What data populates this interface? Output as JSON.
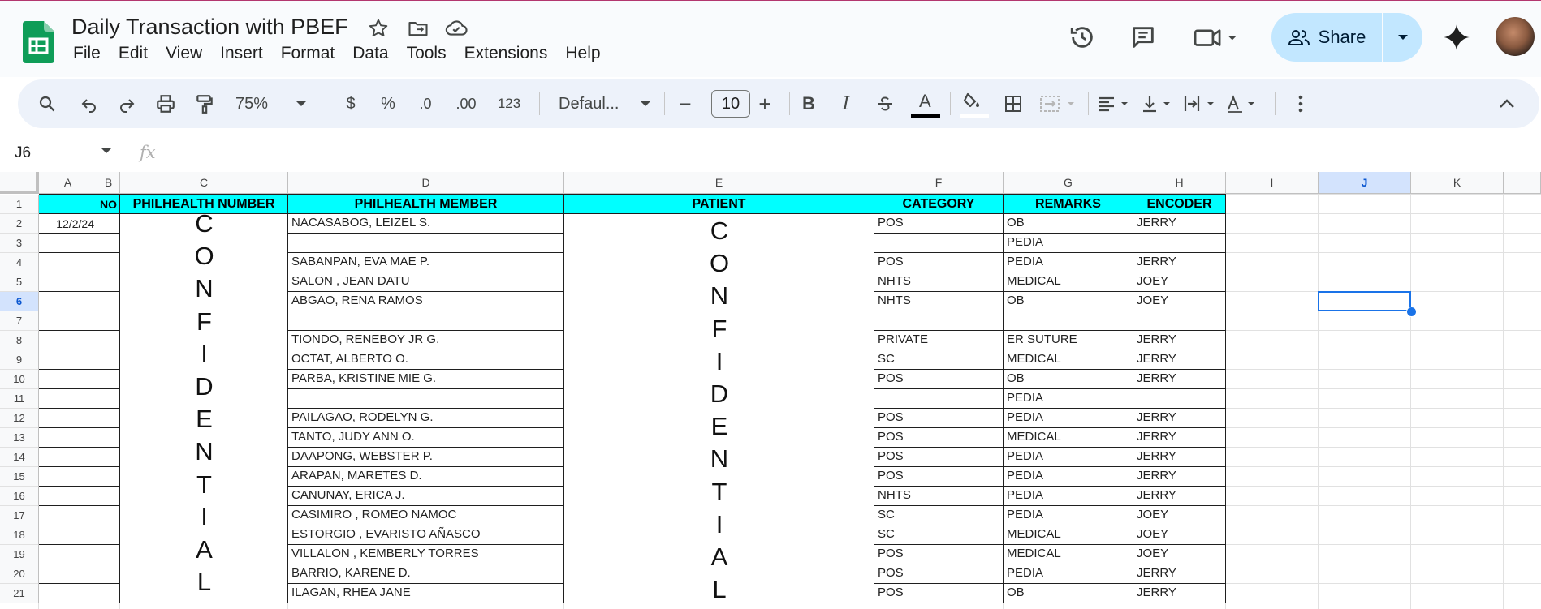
{
  "app": {
    "title": "Daily Transaction with PBEF",
    "menu": [
      "File",
      "Edit",
      "View",
      "Insert",
      "Format",
      "Data",
      "Tools",
      "Extensions",
      "Help"
    ],
    "share_label": "Share"
  },
  "toolbar": {
    "zoom": "75%",
    "currency": "$",
    "percent": "%",
    "dec_decrease": ".0",
    "dec_increase": ".00",
    "num_format": "123",
    "font": "Defaul...",
    "font_size": "10",
    "minus": "−",
    "plus": "+",
    "bold": "B",
    "italic": "I",
    "text_color": "A"
  },
  "formula_bar": {
    "cell_ref": "J6",
    "fx": "fx",
    "value": ""
  },
  "sheet": {
    "columns": [
      "A",
      "B",
      "C",
      "D",
      "E",
      "F",
      "G",
      "H",
      "I",
      "J",
      "K"
    ],
    "selected_column": "J",
    "selected_row": "6",
    "rows": [
      "1",
      "2",
      "3",
      "4",
      "5",
      "6",
      "7",
      "8",
      "9",
      "10",
      "11",
      "12",
      "13",
      "14",
      "15",
      "16",
      "17",
      "18",
      "19",
      "20",
      "21"
    ],
    "headers": {
      "no": "NO",
      "philhealth_number": "PHILHEALTH NUMBER",
      "philhealth_member": "PHILHEALTH MEMBER",
      "patient": "PATIENT",
      "category": "CATEGORY",
      "remarks": "REMARKS",
      "encoder": "ENCODER"
    },
    "date_a2": "12/2/24",
    "confidential_c": [
      "C",
      "O",
      "N",
      "F",
      "I",
      "D",
      "E",
      "N",
      "T",
      "I",
      "A",
      "L"
    ],
    "confidential_e": [
      "C",
      "O",
      "N",
      "F",
      "I",
      "D",
      "E",
      "N",
      "T",
      "I",
      "A",
      "L"
    ],
    "data_rows": [
      {
        "member": "NACASABOG, LEIZEL S.",
        "category": "POS",
        "remarks": "OB",
        "encoder": "JERRY"
      },
      {
        "member": "",
        "category": "",
        "remarks": "PEDIA",
        "encoder": ""
      },
      {
        "member": "SABANPAN, EVA MAE P.",
        "category": "POS",
        "remarks": "PEDIA",
        "encoder": "JERRY"
      },
      {
        "member": "SALON , JEAN DATU",
        "category": "NHTS",
        "remarks": "MEDICAL",
        "encoder": "JOEY"
      },
      {
        "member": "ABGAO, RENA RAMOS",
        "category": "NHTS",
        "remarks": "OB",
        "encoder": "JOEY"
      },
      {
        "member": "",
        "category": "",
        "remarks": "",
        "encoder": ""
      },
      {
        "member": "TIONDO, RENEBOY JR G.",
        "category": "PRIVATE",
        "remarks": "ER SUTURE",
        "encoder": "JERRY"
      },
      {
        "member": "OCTAT, ALBERTO O.",
        "category": "SC",
        "remarks": "MEDICAL",
        "encoder": "JERRY"
      },
      {
        "member": "PARBA, KRISTINE MIE G.",
        "category": "POS",
        "remarks": "OB",
        "encoder": "JERRY"
      },
      {
        "member": "",
        "category": "",
        "remarks": "PEDIA",
        "encoder": ""
      },
      {
        "member": "PAILAGAO, RODELYN G.",
        "category": "POS",
        "remarks": "PEDIA",
        "encoder": "JERRY"
      },
      {
        "member": "TANTO, JUDY ANN O.",
        "category": "POS",
        "remarks": "MEDICAL",
        "encoder": "JERRY"
      },
      {
        "member": "DAAPONG, WEBSTER P.",
        "category": "POS",
        "remarks": "PEDIA",
        "encoder": "JERRY"
      },
      {
        "member": "ARAPAN, MARETES D.",
        "category": "POS",
        "remarks": "PEDIA",
        "encoder": "JERRY"
      },
      {
        "member": "CANUNAY, ERICA J.",
        "category": "NHTS",
        "remarks": "PEDIA",
        "encoder": "JERRY"
      },
      {
        "member": "CASIMIRO , ROMEO NAMOC",
        "category": "SC",
        "remarks": "PEDIA",
        "encoder": "JOEY"
      },
      {
        "member": "ESTORGIO , EVARISTO AÑASCO",
        "category": "SC",
        "remarks": "MEDICAL",
        "encoder": "JOEY"
      },
      {
        "member": "VILLALON , KEMBERLY TORRES",
        "category": "POS",
        "remarks": "MEDICAL",
        "encoder": "JOEY"
      },
      {
        "member": "BARRIO, KARENE D.",
        "category": "POS",
        "remarks": "PEDIA",
        "encoder": "JERRY"
      },
      {
        "member": "ILAGAN, RHEA JANE",
        "category": "POS",
        "remarks": "OB",
        "encoder": "JERRY"
      }
    ]
  },
  "colors": {
    "header_fill": "#00ffff",
    "accent": "#1a73e8",
    "share_bg": "#c2e7ff",
    "sheets_green": "#0f9d58"
  }
}
